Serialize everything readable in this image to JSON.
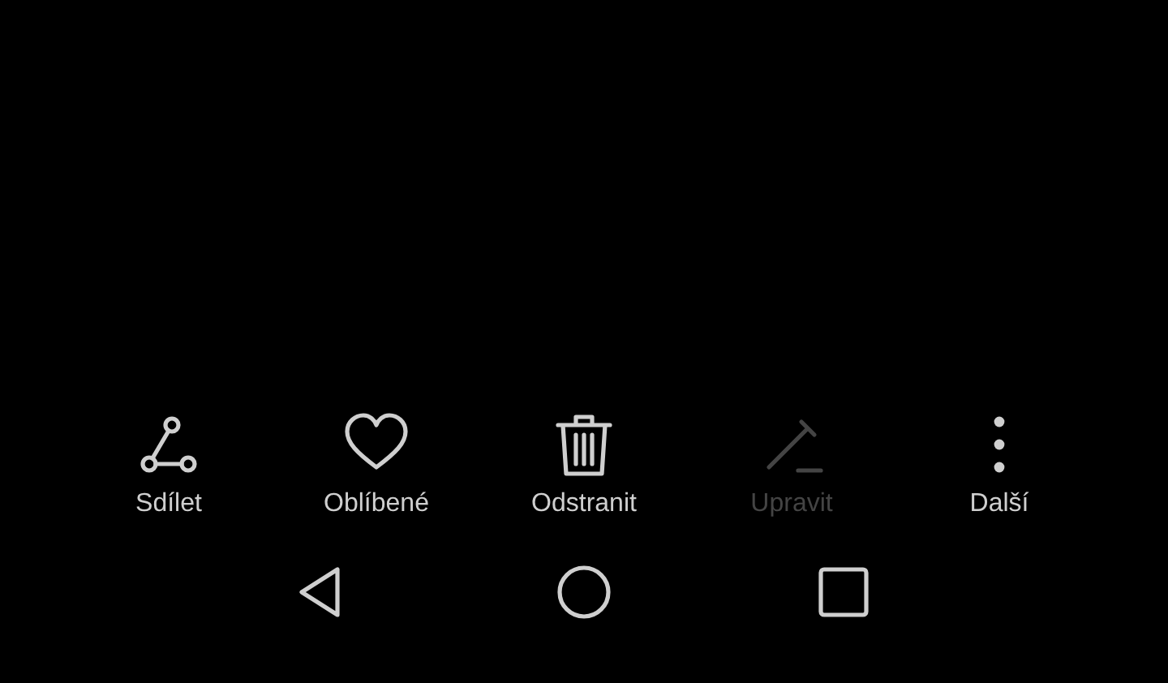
{
  "actions": [
    {
      "kind": "share",
      "label": "Sdílet",
      "disabled": false
    },
    {
      "kind": "favorite",
      "label": "Oblíbené",
      "disabled": false
    },
    {
      "kind": "delete",
      "label": "Odstranit",
      "disabled": false
    },
    {
      "kind": "edit",
      "label": "Upravit",
      "disabled": true
    },
    {
      "kind": "more",
      "label": "Další",
      "disabled": false
    }
  ],
  "nav_bar": [
    {
      "kind": "back"
    },
    {
      "kind": "home"
    },
    {
      "kind": "recents"
    }
  ]
}
